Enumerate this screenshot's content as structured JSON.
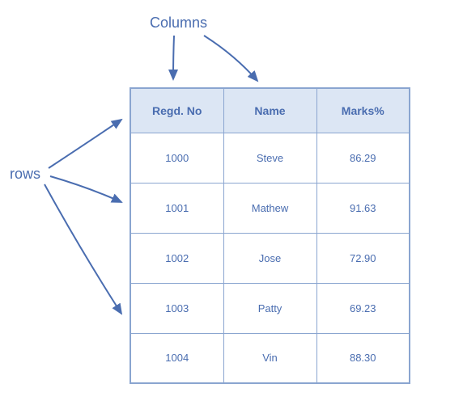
{
  "labels": {
    "columns": "Columns",
    "rows": "rows"
  },
  "table": {
    "headers": [
      "Regd. No",
      "Name",
      "Marks%"
    ],
    "rows": [
      {
        "regd": "1000",
        "name": "Steve",
        "marks": "86.29"
      },
      {
        "regd": "1001",
        "name": "Mathew",
        "marks": "91.63"
      },
      {
        "regd": "1002",
        "name": "Jose",
        "marks": "72.90"
      },
      {
        "regd": "1003",
        "name": "Patty",
        "marks": "69.23"
      },
      {
        "regd": "1004",
        "name": "Vin",
        "marks": "88.30"
      }
    ]
  },
  "chart_data": {
    "type": "table",
    "title": "",
    "columns": [
      "Regd. No",
      "Name",
      "Marks%"
    ],
    "data": [
      [
        "1000",
        "Steve",
        86.29
      ],
      [
        "1001",
        "Mathew",
        91.63
      ],
      [
        "1002",
        "Jose",
        72.9
      ],
      [
        "1003",
        "Patty",
        69.23
      ],
      [
        "1004",
        "Vin",
        88.3
      ]
    ],
    "annotations": {
      "columns_label_points_to": "table column headers",
      "rows_label_points_to": "table data rows"
    }
  }
}
